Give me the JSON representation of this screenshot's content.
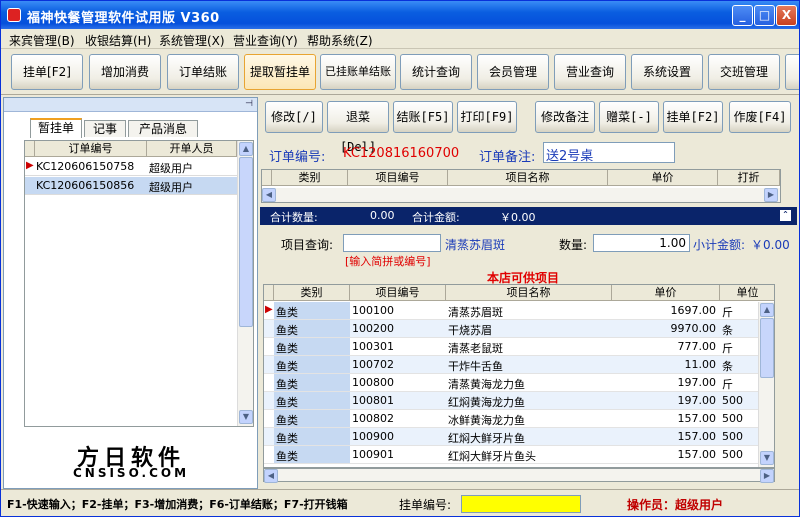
{
  "window": {
    "title": "福神快餐管理软件试用版  V360",
    "min": "_",
    "max": "□",
    "close": "X"
  },
  "menu": [
    "来宾管理(B)",
    "收银结算(H)",
    "系统管理(X)",
    "营业查询(Y)",
    "帮助系统(Z)"
  ],
  "toolbar": [
    "挂单[F2]",
    "增加消费",
    "订单结账",
    "提取暂挂单",
    "已挂账单结账",
    "统计查询",
    "会员管理",
    "营业查询",
    "系统设置",
    "交班管理"
  ],
  "left": {
    "tabs": [
      "暂挂单",
      "记事",
      "产品消息"
    ],
    "columns": [
      "订单编号",
      "开单人员"
    ],
    "rows": [
      {
        "id": "KC120606150758",
        "user": "超级用户"
      },
      {
        "id": "KC120606150856",
        "user": "超级用户"
      }
    ],
    "logo_cn": "方日软件",
    "logo_en": "CNSISO.COM"
  },
  "actions": [
    "修改[/]",
    "退菜[Del]",
    "结账[F5]",
    "打印[F9]",
    "修改备注",
    "赠菜[-]",
    "挂单[F2]",
    "作废[F4]"
  ],
  "order": {
    "no_label": "订单编号:",
    "no": "KC120816160700",
    "note_label": "订单备注:",
    "note": "送2号桌",
    "columns": [
      "类别",
      "项目编号",
      "项目名称",
      "单价",
      "打折"
    ]
  },
  "totals": {
    "count_label": "合计数量:",
    "count": "0.00",
    "amount_label": "合计金额:",
    "amount": "￥0.00"
  },
  "query": {
    "label": "项目查询:",
    "value": "",
    "hint": "清蒸苏眉斑",
    "placeholder": "[输入简拼或编号]",
    "qty_label": "数量:",
    "qty": "1.00",
    "subtotal_label": "小计金额:",
    "subtotal": "￥0.00"
  },
  "products": {
    "title": "本店可供项目",
    "columns": [
      "类别",
      "项目编号",
      "项目名称",
      "单价",
      "单位"
    ],
    "rows": [
      {
        "cat": "鱼类",
        "code": "100100",
        "name": "清蒸苏眉斑",
        "price": "1697.00",
        "unit": "斤"
      },
      {
        "cat": "鱼类",
        "code": "100200",
        "name": "干烧苏眉",
        "price": "9970.00",
        "unit": "条"
      },
      {
        "cat": "鱼类",
        "code": "100301",
        "name": "清蒸老鼠斑",
        "price": "777.00",
        "unit": "斤"
      },
      {
        "cat": "鱼类",
        "code": "100702",
        "name": "干炸牛舌鱼",
        "price": "11.00",
        "unit": "条"
      },
      {
        "cat": "鱼类",
        "code": "100800",
        "name": "清蒸黄海龙力鱼",
        "price": "197.00",
        "unit": "斤"
      },
      {
        "cat": "鱼类",
        "code": "100801",
        "name": "红焖黄海龙力鱼",
        "price": "197.00",
        "unit": "500"
      },
      {
        "cat": "鱼类",
        "code": "100802",
        "name": "冰鲜黄海龙力鱼",
        "price": "157.00",
        "unit": "500"
      },
      {
        "cat": "鱼类",
        "code": "100900",
        "name": "红焖大鲜牙片鱼",
        "price": "157.00",
        "unit": "500"
      },
      {
        "cat": "鱼类",
        "code": "100901",
        "name": "红焖大鲜牙片鱼头",
        "price": "157.00",
        "unit": "500"
      }
    ]
  },
  "status": {
    "shortcuts": "F1-快速输入；F2-挂单；F3-增加消费；F6-订单结账；F7-打开钱箱",
    "hold_label": "挂单编号:",
    "operator": "操作员：超级用户"
  },
  "colors": {
    "title_blue": "#0a5ee0",
    "dark_navy": "#0a246a",
    "red": "#e00000",
    "row_blue": "#eaf2fc",
    "selected": "#c6d9f2"
  }
}
